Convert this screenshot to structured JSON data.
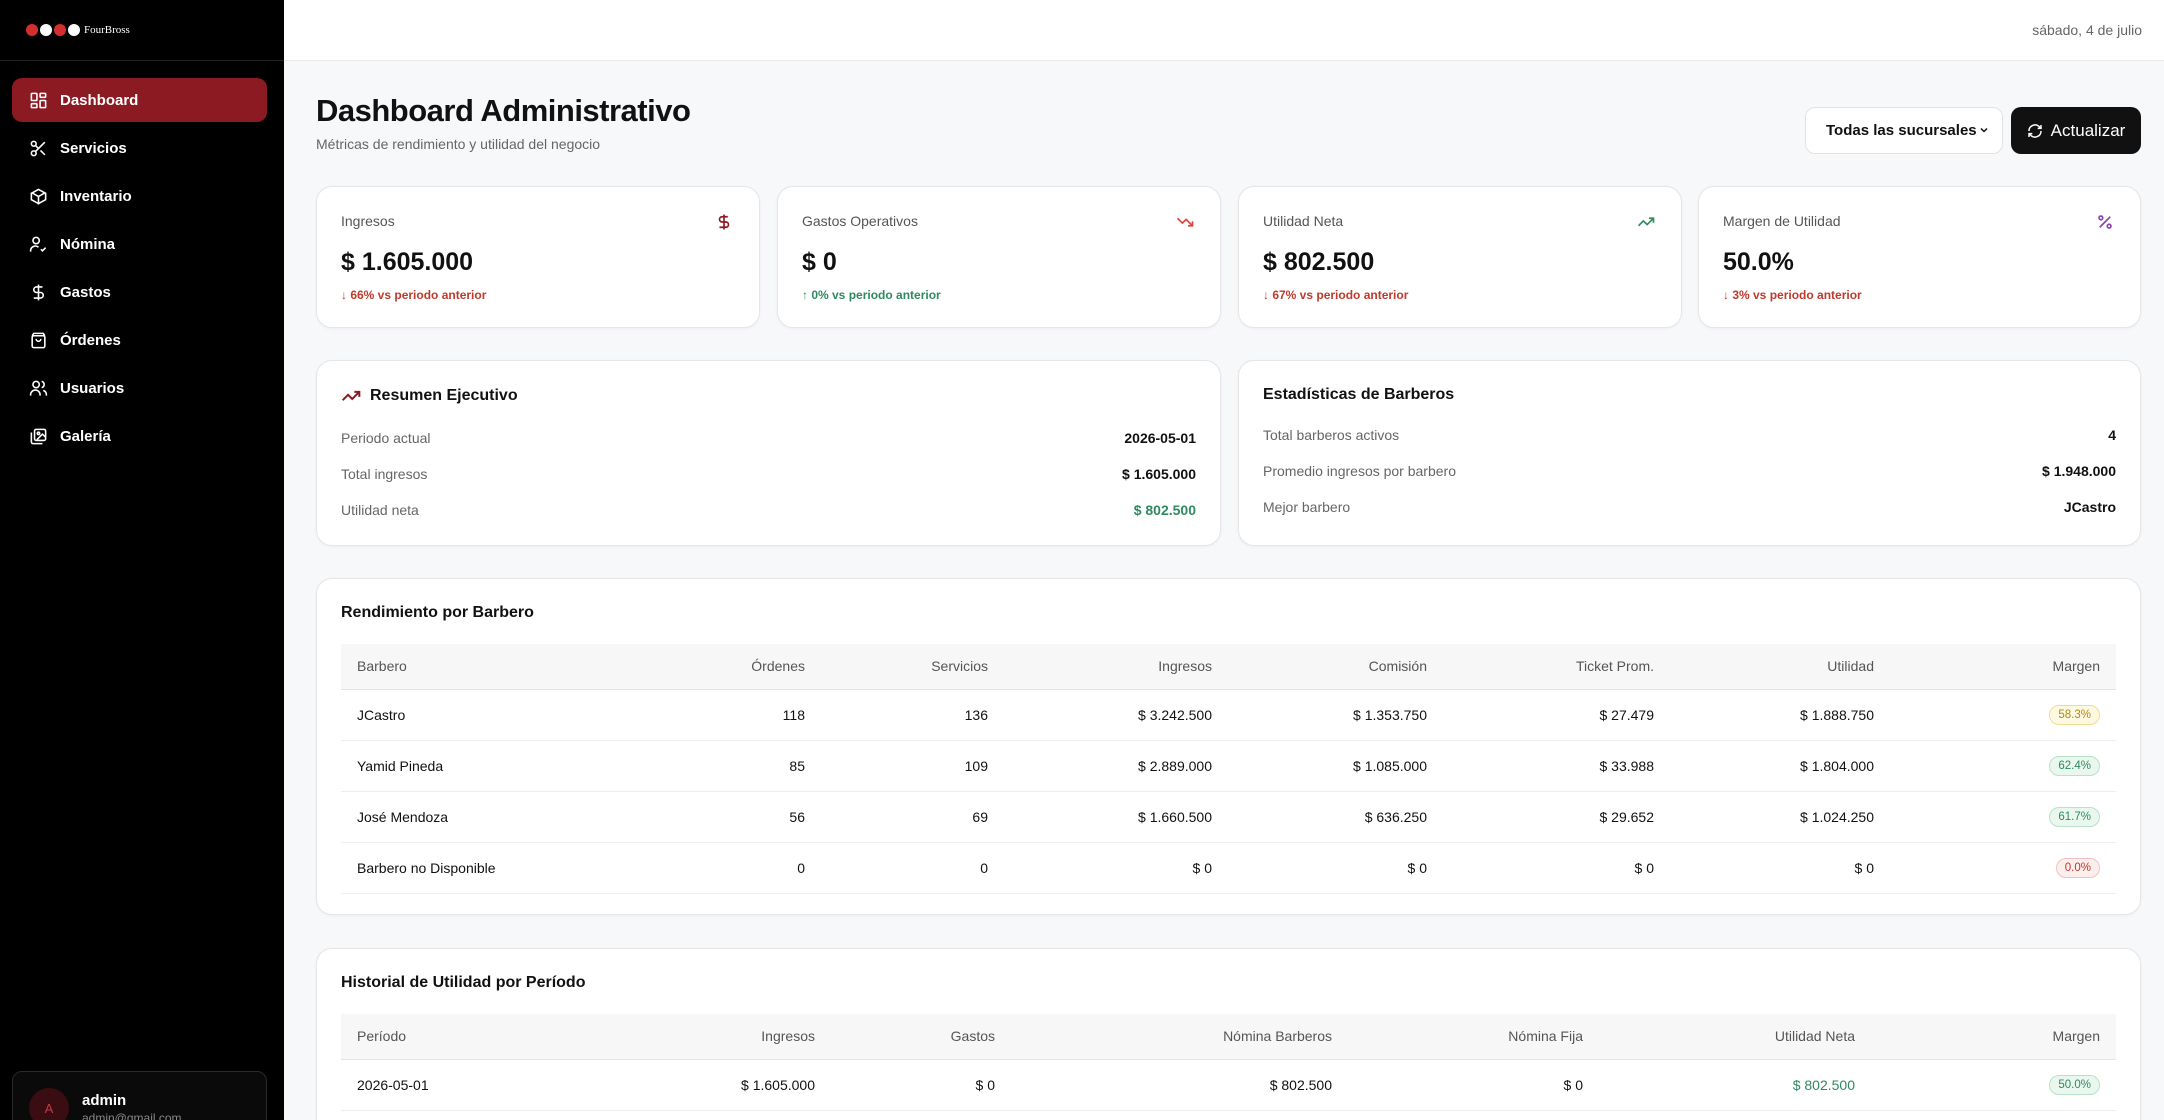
{
  "brand": {
    "name": "FourBross",
    "dot_colors": [
      "#d32f2f",
      "#ffffff",
      "#d32f2f",
      "#ffffff"
    ]
  },
  "sidebar": {
    "items": [
      {
        "label": "Dashboard",
        "icon": "dashboard-grid-icon",
        "active": true
      },
      {
        "label": "Servicios",
        "icon": "scissors-icon"
      },
      {
        "label": "Inventario",
        "icon": "box-icon"
      },
      {
        "label": "Nómina",
        "icon": "user-check-icon"
      },
      {
        "label": "Gastos",
        "icon": "dollar-icon"
      },
      {
        "label": "Órdenes",
        "icon": "shopping-bag-icon"
      },
      {
        "label": "Usuarios",
        "icon": "users-icon"
      },
      {
        "label": "Galería",
        "icon": "gallery-icon"
      }
    ],
    "user": {
      "initial": "A",
      "name": "admin",
      "email": "admin@gmail.com"
    }
  },
  "topbar": {
    "date": "sábado, 4 de julio"
  },
  "header": {
    "title": "Dashboard Administrativo",
    "subtitle": "Métricas de rendimiento y utilidad del negocio",
    "branch_select": "Todas las sucursales",
    "refresh_label": "Actualizar"
  },
  "kpis": [
    {
      "label": "Ingresos",
      "value": "$ 1.605.000",
      "change": "↓ 66% vs periodo anterior",
      "trend": "down",
      "icon": "dollar-icon",
      "icon_color": "#8b1a22"
    },
    {
      "label": "Gastos Operativos",
      "value": "$ 0",
      "change": "↑ 0% vs periodo anterior",
      "trend": "up",
      "icon": "trending-down-icon",
      "icon_color": "#d9453b"
    },
    {
      "label": "Utilidad Neta",
      "value": "$ 802.500",
      "change": "↓ 67% vs periodo anterior",
      "trend": "down",
      "icon": "trending-up-icon",
      "icon_color": "#2f8a5f"
    },
    {
      "label": "Margen de Utilidad",
      "value": "50.0%",
      "change": "↓ 3% vs periodo anterior",
      "trend": "down",
      "icon": "percent-icon",
      "icon_color": "#8e44ad"
    }
  ],
  "resumen": {
    "title": "Resumen Ejecutivo",
    "rows": [
      {
        "label": "Periodo actual",
        "value": "2026-05-01"
      },
      {
        "label": "Total ingresos",
        "value": "$ 1.605.000"
      },
      {
        "label": "Utilidad neta",
        "value": "$ 802.500"
      }
    ]
  },
  "estadisticas": {
    "title": "Estadísticas de Barberos",
    "rows": [
      {
        "label": "Total barberos activos",
        "value": "4"
      },
      {
        "label": "Promedio ingresos por barbero",
        "value": "$ 1.948.000"
      },
      {
        "label": "Mejor barbero",
        "value": "JCastro"
      }
    ]
  },
  "rendimiento": {
    "title": "Rendimiento por Barbero",
    "columns": [
      "Barbero",
      "Órdenes",
      "Servicios",
      "Ingresos",
      "Comisión",
      "Ticket Prom.",
      "Utilidad",
      "Margen"
    ],
    "rows": [
      {
        "cells": [
          "JCastro",
          "118",
          "136",
          "$ 3.242.500",
          "$ 1.353.750",
          "$ 27.479",
          "$ 1.888.750"
        ],
        "margin": "58.3%",
        "status": "yellow"
      },
      {
        "cells": [
          "Yamid Pineda",
          "85",
          "109",
          "$ 2.889.000",
          "$ 1.085.000",
          "$ 33.988",
          "$ 1.804.000"
        ],
        "margin": "62.4%",
        "status": "green"
      },
      {
        "cells": [
          "José Mendoza",
          "56",
          "69",
          "$ 1.660.500",
          "$ 636.250",
          "$ 29.652",
          "$ 1.024.250"
        ],
        "margin": "61.7%",
        "status": "green"
      },
      {
        "cells": [
          "Barbero no Disponible",
          "0",
          "0",
          "$ 0",
          "$ 0",
          "$ 0",
          "$ 0"
        ],
        "margin": "0.0%",
        "status": "red"
      }
    ]
  },
  "historial": {
    "title": "Historial de Utilidad por Período",
    "columns": [
      "Período",
      "Ingresos",
      "Gastos",
      "Nómina Barberos",
      "Nómina Fija",
      "Utilidad Neta",
      "Margen"
    ],
    "rows": [
      {
        "cells": [
          "2026-05-01",
          "$ 1.605.000",
          "$ 0",
          "$ 802.500",
          "$ 0",
          "$ 802.500"
        ],
        "margin": "50.0%",
        "status": "green"
      }
    ]
  }
}
